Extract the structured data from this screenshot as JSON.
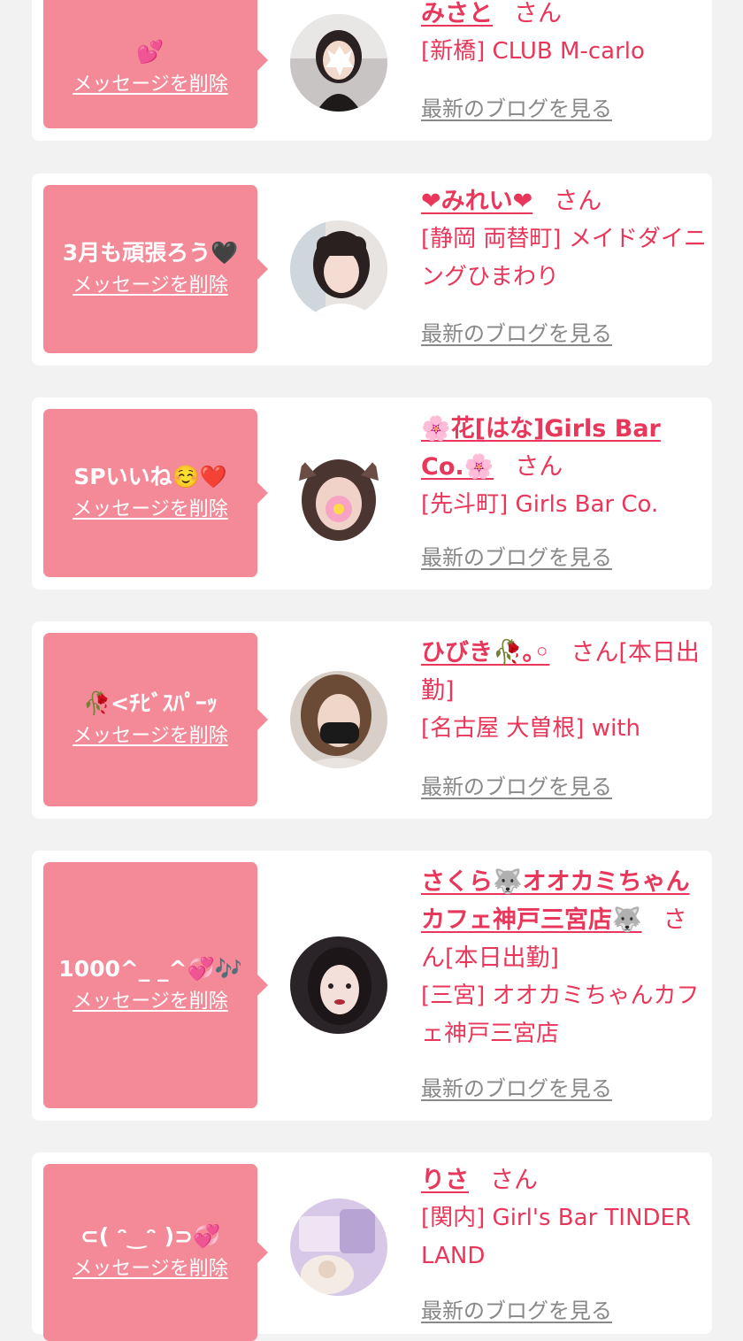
{
  "labels": {
    "delete": "メッセージを削除",
    "san": "さん",
    "blog": "最新のブログを見る"
  },
  "colors": {
    "bubble": "#f48a98",
    "accent": "#e8375a",
    "link_gray": "#888888",
    "background": "#f2f2f2",
    "card": "#ffffff"
  },
  "items": [
    {
      "message": "💕",
      "name": "みさと",
      "name_suffix": "",
      "shop": "[新橋] CLUB M-carlo",
      "avatar_icon": "avatar-photo-icon"
    },
    {
      "message": "3月も頑張ろう🖤",
      "name": "❤みれい❤",
      "name_suffix": "",
      "shop": "[静岡 両替町] メイドダイニングひまわり",
      "avatar_icon": "avatar-photo-icon"
    },
    {
      "message": "SPいいね☺️❤️",
      "name": "🌸花[はな]Girls Bar Co.🌸",
      "name_suffix": "",
      "shop": "[先斗町] Girls Bar Co.",
      "avatar_icon": "avatar-photo-icon"
    },
    {
      "message": "🥀<ﾁﾋﾞｽﾊﾟｰｯ",
      "name": "ひびき🥀｡◦",
      "name_suffix": "[本日出勤]",
      "shop": "[名古屋 大曽根] with",
      "avatar_icon": "avatar-photo-icon"
    },
    {
      "message": "1000^_ _^💞🎶",
      "name": "さくら🐺オオカミちゃんカフェ神戸三宮店🐺",
      "name_suffix": "[本日出勤]",
      "shop": "[三宮] オオカミちゃんカフェ神戸三宮店",
      "avatar_icon": "avatar-photo-icon"
    },
    {
      "message": "⊂( ᵔ‿ᵔ )⊃💞",
      "name": "りさ",
      "name_suffix": "",
      "shop": "[関内] Girl's Bar TINDER LAND",
      "avatar_icon": "avatar-photo-icon"
    }
  ]
}
